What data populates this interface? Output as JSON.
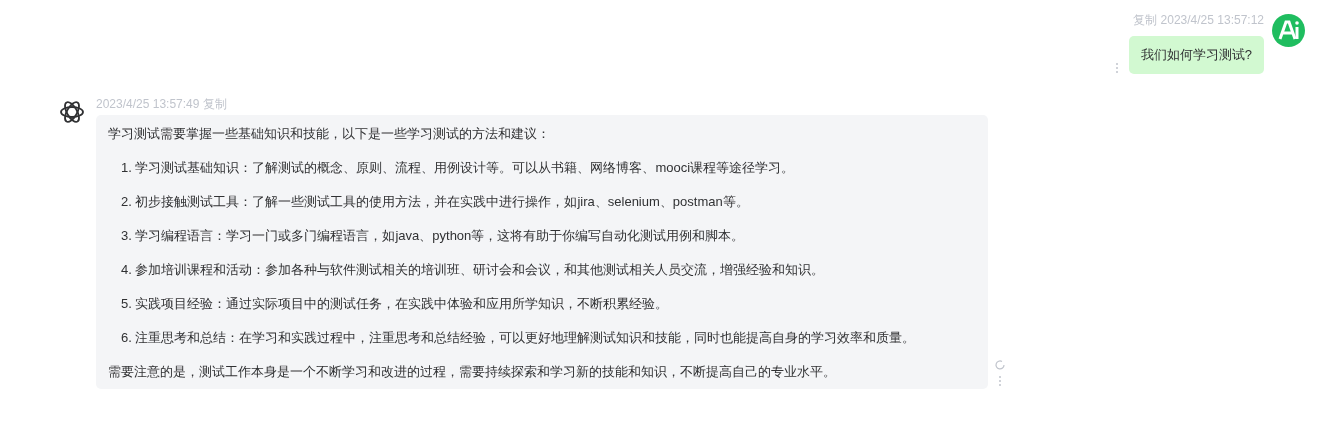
{
  "user_message": {
    "copy_label": "复制",
    "time": "2023/4/25 13:57:12",
    "text": "我们如何学习测试?"
  },
  "assistant_message": {
    "time": "2023/4/25 13:57:49",
    "copy_label": "复制",
    "paragraphs": [
      {
        "kind": "text",
        "text": "学习测试需要掌握一些基础知识和技能，以下是一些学习测试的方法和建议："
      },
      {
        "kind": "item",
        "text": "1. 学习测试基础知识：了解测试的概念、原则、流程、用例设计等。可以从书籍、网络博客、mooci课程等途径学习。"
      },
      {
        "kind": "item",
        "text": "2. 初步接触测试工具：了解一些测试工具的使用方法，并在实践中进行操作，如jira、selenium、postman等。"
      },
      {
        "kind": "item",
        "text": "3. 学习编程语言：学习一门或多门编程语言，如java、python等，这将有助于你编写自动化测试用例和脚本。"
      },
      {
        "kind": "item",
        "text": "4. 参加培训课程和活动：参加各种与软件测试相关的培训班、研讨会和会议，和其他测试相关人员交流，增强经验和知识。"
      },
      {
        "kind": "item",
        "text": "5. 实践项目经验：通过实际项目中的测试任务，在实践中体验和应用所学知识，不断积累经验。"
      },
      {
        "kind": "item",
        "text": "6. 注重思考和总结：在学习和实践过程中，注重思考和总结经验，可以更好地理解测试知识和技能，同时也能提高自身的学习效率和质量。"
      },
      {
        "kind": "text",
        "text": "需要注意的是，测试工作本身是一个不断学习和改进的过程，需要持续探索和学习新的技能和知识，不断提高自己的专业水平。"
      }
    ]
  }
}
